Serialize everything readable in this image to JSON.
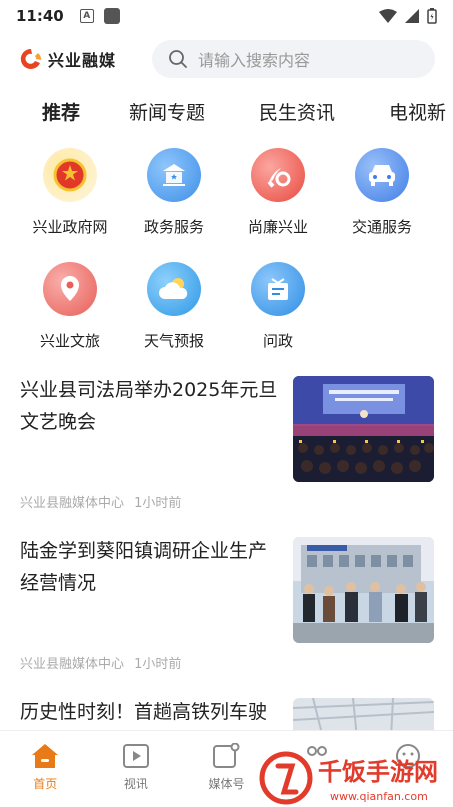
{
  "status_bar": {
    "time": "11:40",
    "a_icon_letter": "A"
  },
  "header": {
    "logo_text": "兴业融媒",
    "search_placeholder": "请输入搜索内容"
  },
  "tabs": [
    "推荐",
    "新闻专题",
    "民生资讯",
    "电视新"
  ],
  "services": [
    {
      "label": "兴业政府网",
      "icon": "national-emblem-icon",
      "color": "#f7c23a"
    },
    {
      "label": "政务服务",
      "icon": "government-building-icon",
      "color": "#4b9ff0"
    },
    {
      "label": "尚廉兴业",
      "icon": "party-emblem-icon",
      "color": "#ee5e52"
    },
    {
      "label": "交通服务",
      "icon": "car-icon",
      "color": "#4a86e8"
    },
    {
      "label": "兴业文旅",
      "icon": "map-pin-icon",
      "color": "#ec6c67"
    },
    {
      "label": "天气预报",
      "icon": "cloud-sun-icon",
      "color": "#3fa8e8"
    },
    {
      "label": "问政",
      "icon": "message-board-icon",
      "color": "#3a9ae6"
    }
  ],
  "news": [
    {
      "title": "兴业县司法局举办2025年元旦文艺晚会",
      "source": "兴业县融媒体中心",
      "time": "1小时前",
      "image": "stage-performance-photo"
    },
    {
      "title": "陆金学到葵阳镇调研企业生产经营情况",
      "source": "兴业县融媒体中心",
      "time": "1小时前",
      "image": "officials-group-photo"
    },
    {
      "title": "历史性时刻！首趟高铁列车驶入兴业车站",
      "image": "railway-station-photo"
    }
  ],
  "bottom_nav": [
    {
      "label": "首页",
      "icon": "home-icon",
      "active": true
    },
    {
      "label": "视讯",
      "icon": "video-play-icon",
      "active": false
    },
    {
      "label": "媒体号",
      "icon": "media-account-icon",
      "active": false
    },
    {
      "label": "",
      "icon": "people-icon",
      "active": false
    },
    {
      "label": "",
      "icon": "profile-icon",
      "active": false
    }
  ],
  "watermark": {
    "text": "千饭手游网",
    "url_text": "www.qianfan.com"
  },
  "colors": {
    "accent": "#e87b17",
    "search_bg": "#f1f3f6",
    "meta": "#aaaaaa"
  }
}
